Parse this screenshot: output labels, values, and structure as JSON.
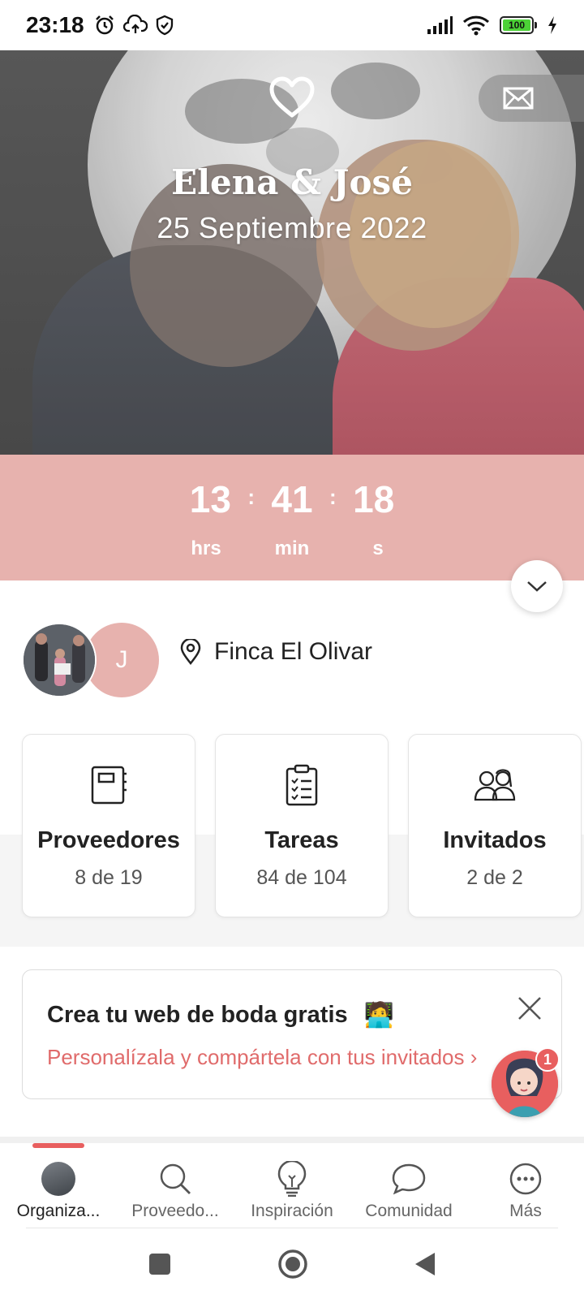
{
  "status_bar": {
    "time": "23:18",
    "left_icons": [
      "alarm-icon",
      "cloud-upload-icon",
      "shield-check-icon"
    ],
    "right_icons": [
      "signal-icon",
      "wifi-icon",
      "battery-icon",
      "charging-icon"
    ],
    "battery_level": "100"
  },
  "hero": {
    "names": "Elena & José",
    "date": "25 Septiembre 2022",
    "icons": [
      "heart-icon",
      "mail-icon"
    ]
  },
  "countdown": {
    "hours": "13",
    "minutes": "41",
    "seconds": "18",
    "separator": ":",
    "hours_label": "hrs",
    "minutes_label": "min",
    "seconds_label": "s"
  },
  "couple": {
    "initial": "J",
    "venue": "Finca El Olivar"
  },
  "cards": [
    {
      "title": "Proveedores",
      "subtitle": "8 de 19",
      "icon": "notebook-icon"
    },
    {
      "title": "Tareas",
      "subtitle": "84 de 104",
      "icon": "checklist-icon"
    },
    {
      "title": "Invitados",
      "subtitle": "2 de 2",
      "icon": "guests-icon"
    }
  ],
  "promo": {
    "title": "Crea tu web de boda gratis",
    "emoji": "🧑‍💻",
    "subtitle": "Personalízala y compártela con tus invitados",
    "arrow": "›"
  },
  "chat": {
    "badge": "1"
  },
  "nav": {
    "items": [
      {
        "label": "Organiza...",
        "icon": "profile-avatar-icon",
        "active": true
      },
      {
        "label": "Proveedo...",
        "icon": "search-icon",
        "active": false
      },
      {
        "label": "Inspiración",
        "icon": "lightbulb-icon",
        "active": false
      },
      {
        "label": "Comunidad",
        "icon": "chat-bubble-icon",
        "active": false
      },
      {
        "label": "Más",
        "icon": "more-icon",
        "active": false
      }
    ]
  },
  "colors": {
    "accent_pink": "#e7b2ae",
    "accent_red": "#e85f5f",
    "promo_text": "#e06b6b"
  }
}
